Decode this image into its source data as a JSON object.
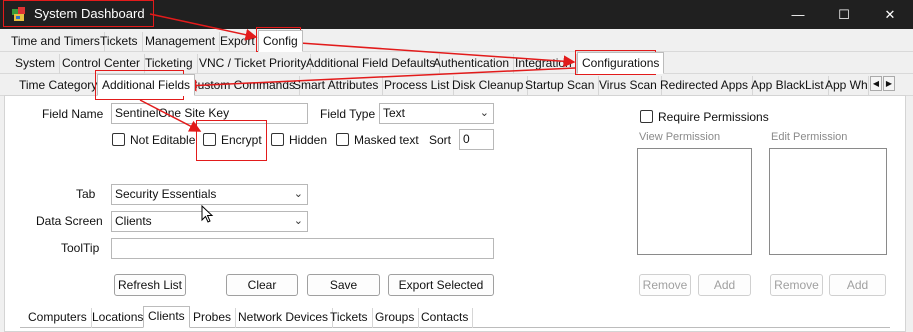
{
  "window": {
    "title": "System Dashboard",
    "icon": "app-icon",
    "controls": [
      "—",
      "☐",
      "✕"
    ]
  },
  "menu_tabs": [
    "Time and Timers",
    "Tickets",
    "Management",
    "Export",
    "Config"
  ],
  "config_tabs": [
    "System",
    "Control Center",
    "Ticketing",
    "VNC / Ticket Priority",
    "Additional Field Defaults",
    "Authentication",
    "Integration",
    "Configurations"
  ],
  "config_sub_tabs": [
    "Time Category",
    "Additional Fields",
    "Custom Commands",
    "Smart Attributes",
    "Process List",
    "Disk Cleanup",
    "Startup Scan",
    "Virus Scan",
    "Redirected Apps",
    "App BlackList",
    "App Whit"
  ],
  "form": {
    "field_name_label": "Field Name",
    "field_name_value": "SentinelOne Site Key",
    "field_type_label": "Field Type",
    "field_type_value": "Text",
    "not_editable_label": "Not Editable",
    "encrypt_label": "Encrypt",
    "hidden_label": "Hidden",
    "masked_label": "Masked text",
    "sort_label": "Sort",
    "sort_value": "0",
    "tab_label": "Tab",
    "tab_value": "Security Essentials",
    "data_screen_label": "Data Screen",
    "data_screen_value": "Clients",
    "tooltip_label": "ToolTip",
    "tooltip_value": ""
  },
  "permissions": {
    "require_label": "Require Permissions",
    "view_label": "View Permission",
    "edit_label": "Edit Permission",
    "remove_label": "Remove",
    "add_label": "Add"
  },
  "buttons": {
    "refresh": "Refresh List",
    "clear": "Clear",
    "save": "Save",
    "export": "Export Selected"
  },
  "bottom_tabs": [
    "Computers",
    "Locations",
    "Clients",
    "Probes",
    "Network Devices",
    "Tickets",
    "Groups",
    "Contacts"
  ],
  "colors": {
    "titlebar": "#202020",
    "annotation_red": "#e21b1b"
  }
}
